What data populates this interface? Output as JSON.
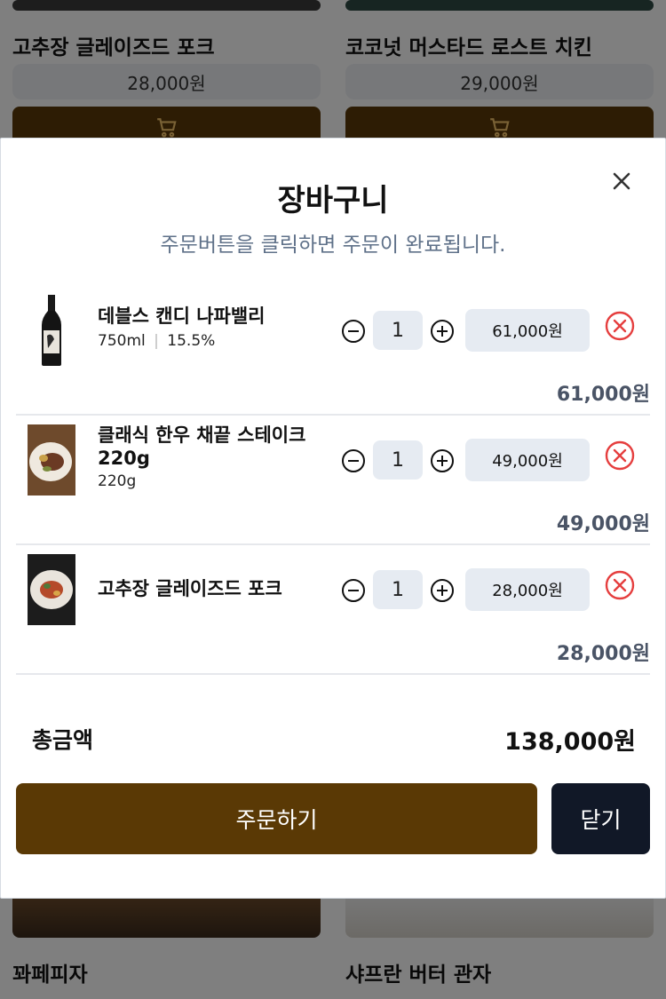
{
  "background_menu": {
    "top_cards": [
      {
        "name": "고추장 글레이즈드 포크",
        "price": "28,000원"
      },
      {
        "name": "코코넛 머스타드 로스트 치킨",
        "price": "29,000원"
      }
    ],
    "bottom_cards": [
      {
        "name": "꽈페피자"
      },
      {
        "name": "샤프란 버터 관자"
      }
    ],
    "cart_icon": "shopping-cart-icon"
  },
  "cart": {
    "title": "장바구니",
    "subtitle": "주문버튼을 클릭하면 주문이 완료됩니다.",
    "close_icon": "close-icon",
    "items": [
      {
        "name": "데블스 캔디 나파밸리",
        "meta": [
          "750ml",
          "15.5%"
        ],
        "quantity": "1",
        "unit_price": "61,000원",
        "line_total": "61,000원",
        "thumb": "wine-bottle"
      },
      {
        "name": "클래식 한우 채끝 스테이크 220g",
        "meta": [
          "220g"
        ],
        "quantity": "1",
        "unit_price": "49,000원",
        "line_total": "49,000원",
        "thumb": "steak-plate"
      },
      {
        "name": "고추장 글레이즈드 포크",
        "meta": [],
        "quantity": "1",
        "unit_price": "28,000원",
        "line_total": "28,000원",
        "thumb": "pork-plate"
      }
    ],
    "total_label": "총금액",
    "total_value": "138,000원",
    "order_button": "주문하기",
    "close_button": "닫기"
  },
  "colors": {
    "brand_brown": "#5a3905",
    "close_button_bg": "#111827",
    "remove_red": "#e53e3e",
    "subtitle_blue_gray": "#5f7189",
    "pill_bg": "#e6ebf2"
  }
}
